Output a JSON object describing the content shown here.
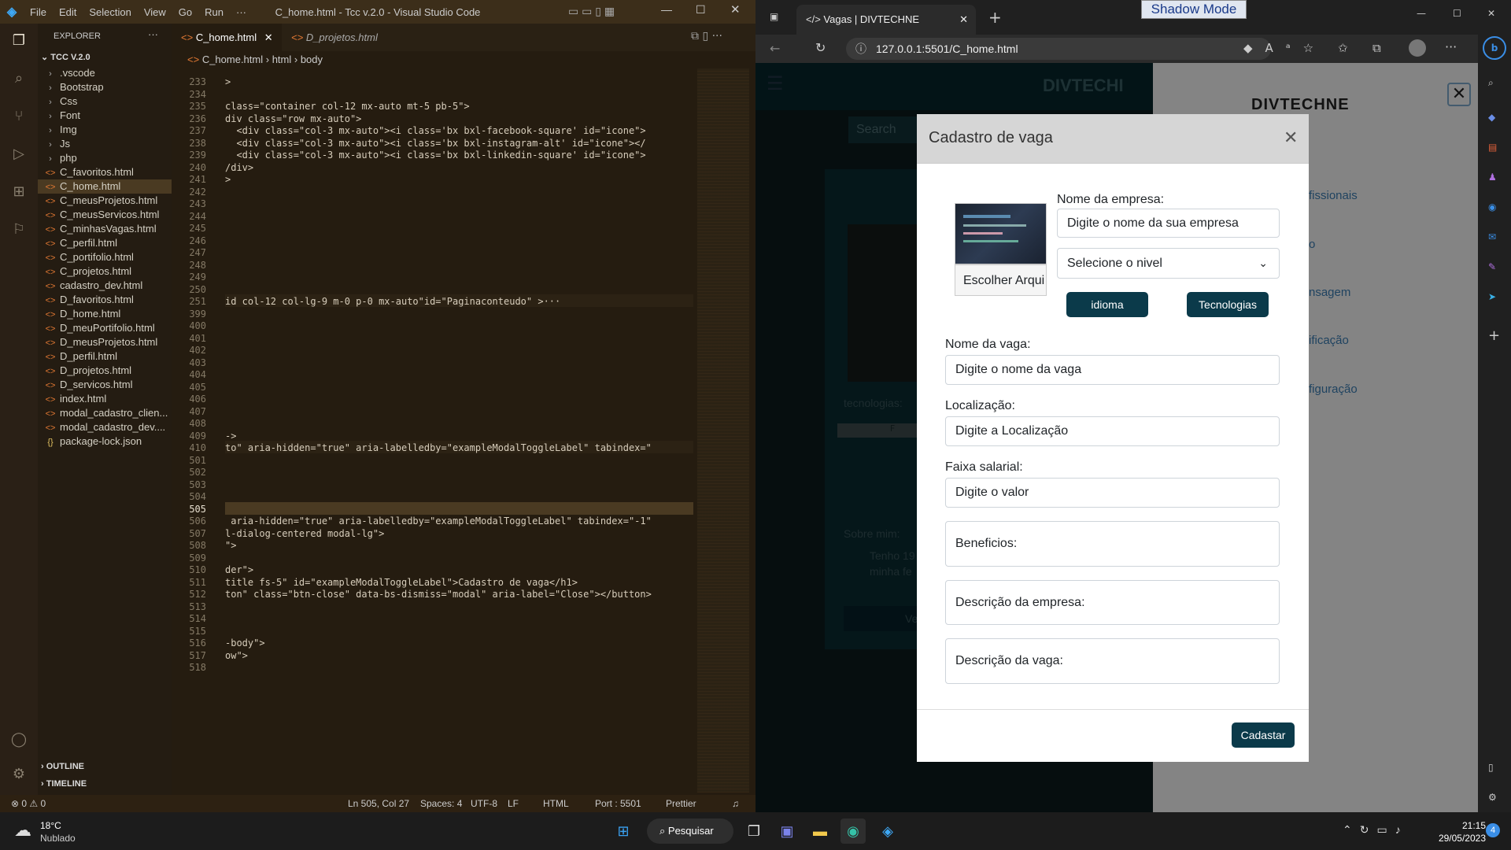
{
  "vscode": {
    "title": "C_home.html - Tcc v.2.0 - Visual Studio Code",
    "menu": [
      "File",
      "Edit",
      "Selection",
      "View",
      "Go",
      "Run",
      "···"
    ],
    "explorer_title": "EXPLORER",
    "explorer_more": "···",
    "project": "TCC V.2.0",
    "tree": [
      {
        "label": ".vscode",
        "type": "folder"
      },
      {
        "label": "Bootstrap",
        "type": "folder"
      },
      {
        "label": "Css",
        "type": "folder"
      },
      {
        "label": "Font",
        "type": "folder"
      },
      {
        "label": "Img",
        "type": "folder"
      },
      {
        "label": "Js",
        "type": "folder"
      },
      {
        "label": "php",
        "type": "folder"
      },
      {
        "label": "C_favoritos.html",
        "type": "file"
      },
      {
        "label": "C_home.html",
        "type": "file",
        "selected": true
      },
      {
        "label": "C_meusProjetos.html",
        "type": "file"
      },
      {
        "label": "C_meusServicos.html",
        "type": "file"
      },
      {
        "label": "C_minhasVagas.html",
        "type": "file"
      },
      {
        "label": "C_perfil.html",
        "type": "file"
      },
      {
        "label": "C_portifolio.html",
        "type": "file"
      },
      {
        "label": "C_projetos.html",
        "type": "file"
      },
      {
        "label": "cadastro_dev.html",
        "type": "file"
      },
      {
        "label": "D_favoritos.html",
        "type": "file"
      },
      {
        "label": "D_home.html",
        "type": "file"
      },
      {
        "label": "D_meuPortifolio.html",
        "type": "file"
      },
      {
        "label": "D_meusProjetos.html",
        "type": "file"
      },
      {
        "label": "D_perfil.html",
        "type": "file"
      },
      {
        "label": "D_projetos.html",
        "type": "file"
      },
      {
        "label": "D_servicos.html",
        "type": "file"
      },
      {
        "label": "index.html",
        "type": "file"
      },
      {
        "label": "modal_cadastro_clien...",
        "type": "file"
      },
      {
        "label": "modal_cadastro_dev....",
        "type": "file"
      },
      {
        "label": "package-lock.json",
        "type": "json"
      }
    ],
    "outline": "OUTLINE",
    "timeline": "TIMELINE",
    "tabs": [
      {
        "label": "C_home.html",
        "active": true
      },
      {
        "label": "D_projetos.html",
        "active": false
      }
    ],
    "breadcrumb": [
      "C_home.html",
      "html",
      "body"
    ],
    "lines": [
      {
        "n": "233",
        "code": ">"
      },
      {
        "n": "234",
        "code": ""
      },
      {
        "n": "235",
        "code": "class=\"container col-12 mx-auto mt-5 pb-5\">"
      },
      {
        "n": "236",
        "code": "div class=\"row mx-auto\">"
      },
      {
        "n": "237",
        "code": "  <div class=\"col-3 mx-auto\"><i class='bx bxl-facebook-square' id=\"icone\">"
      },
      {
        "n": "238",
        "code": "  <div class=\"col-3 mx-auto\"><i class='bx bxl-instagram-alt' id=\"icone\"></"
      },
      {
        "n": "239",
        "code": "  <div class=\"col-3 mx-auto\"><i class='bx bxl-linkedin-square' id=\"icone\">"
      },
      {
        "n": "240",
        "code": "/div>"
      },
      {
        "n": "241",
        "code": ">"
      },
      {
        "n": "242",
        "code": ""
      },
      {
        "n": "243",
        "code": ""
      },
      {
        "n": "244",
        "code": ""
      },
      {
        "n": "245",
        "code": ""
      },
      {
        "n": "246",
        "code": ""
      },
      {
        "n": "247",
        "code": ""
      },
      {
        "n": "248",
        "code": ""
      },
      {
        "n": "249",
        "code": ""
      },
      {
        "n": "250",
        "code": ""
      },
      {
        "n": "251",
        "code": "id col-12 col-lg-9 m-0 p-0 mx-auto\"id=\"Paginaconteudo\" >···"
      },
      {
        "n": "399",
        "code": ""
      },
      {
        "n": "400",
        "code": ""
      },
      {
        "n": "401",
        "code": ""
      },
      {
        "n": "402",
        "code": ""
      },
      {
        "n": "403",
        "code": ""
      },
      {
        "n": "404",
        "code": ""
      },
      {
        "n": "405",
        "code": ""
      },
      {
        "n": "406",
        "code": ""
      },
      {
        "n": "407",
        "code": ""
      },
      {
        "n": "408",
        "code": ""
      },
      {
        "n": "409",
        "code": "->"
      },
      {
        "n": "410",
        "code": "to\" aria-hidden=\"true\" aria-labelledby=\"exampleModalToggleLabel\" tabindex=\""
      },
      {
        "n": "501",
        "code": ""
      },
      {
        "n": "502",
        "code": ""
      },
      {
        "n": "503",
        "code": ""
      },
      {
        "n": "504",
        "code": ""
      },
      {
        "n": "505",
        "code": ""
      },
      {
        "n": "506",
        "code": " aria-hidden=\"true\" aria-labelledby=\"exampleModalToggleLabel\" tabindex=\"-1\""
      },
      {
        "n": "507",
        "code": "l-dialog-centered modal-lg\">"
      },
      {
        "n": "508",
        "code": "\">"
      },
      {
        "n": "509",
        "code": ""
      },
      {
        "n": "510",
        "code": "der\">"
      },
      {
        "n": "511",
        "code": "title fs-5\" id=\"exampleModalToggleLabel\">Cadastro de vaga</h1>"
      },
      {
        "n": "512",
        "code": "ton\" class=\"btn-close\" data-bs-dismiss=\"modal\" aria-label=\"Close\"></button>"
      },
      {
        "n": "513",
        "code": ""
      },
      {
        "n": "514",
        "code": ""
      },
      {
        "n": "515",
        "code": ""
      },
      {
        "n": "516",
        "code": "-body\">"
      },
      {
        "n": "517",
        "code": "ow\">"
      },
      {
        "n": "518",
        "code": ""
      }
    ],
    "status": {
      "problems": "⊗ 0 ⚠ 0",
      "position": "Ln 505, Col 27",
      "spaces": "Spaces: 4",
      "encoding": "UTF-8",
      "eol": "LF",
      "language": "HTML",
      "port": "Port : 5501",
      "prettier": "Prettier"
    }
  },
  "browser": {
    "tab_title": "Vagas | DIVTECHNE",
    "url": "127.0.0.1:5501/C_home.html",
    "shadow_mode": "Shadow Mode",
    "page": {
      "brand": "DIVTECHI",
      "search_placeholder": "Search",
      "tecnologias": "tecnologias:",
      "sobre": "Sobre mim:",
      "sobre_text_1": "Tenho 19",
      "sobre_text_2": "minha fe",
      "btn_partial": "Ve",
      "btn_partial_2": "F",
      "side_brand": "DIVTECHNE",
      "side_items": [
        "fissionais",
        "o",
        "nsagem",
        "ificação",
        "figuração"
      ]
    },
    "modal": {
      "title": "Cadastro de vaga",
      "choose_file": "Escolher Arqui",
      "company_label": "Nome da empresa:",
      "company_placeholder": "Digite o nome da sua empresa",
      "level_select": "Selecione o nivel",
      "idioma_button": "idioma",
      "tecnologias_button": "Tecnologias",
      "job_label": "Nome da vaga:",
      "job_placeholder": "Digite o nome da vaga",
      "location_label": "Localização:",
      "location_placeholder": "Digite a Localização",
      "salary_label": "Faixa salarial:",
      "salary_placeholder": "Digite o valor",
      "benefits_placeholder": "Beneficios:",
      "company_desc_placeholder": "Descrição da empresa:",
      "job_desc_placeholder": "Descrição da vaga:",
      "submit": "Cadastar"
    }
  },
  "taskbar": {
    "weather_temp": "18°C",
    "weather_desc": "Nublado",
    "search": "Pesquisar",
    "time": "21:15",
    "date": "29/05/2023",
    "notifications": "4"
  },
  "colors": {
    "vscode_accent": "#3c2e1a",
    "modal_button": "#0b3a4a",
    "page_bg": "#0b1a1d"
  }
}
